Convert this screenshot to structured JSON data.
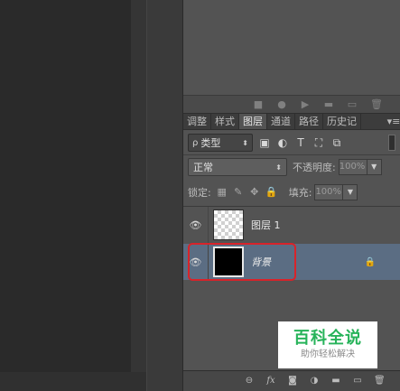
{
  "panel_tabs": [
    "调整",
    "样式",
    "图层",
    "通道",
    "路径",
    "历史记"
  ],
  "active_tab": "图层",
  "tab_menu_icon": "panel-menu-icon",
  "filter": {
    "kind_label": "类型",
    "icons": [
      "image-filter-icon",
      "adjustment-filter-icon",
      "type-filter-icon",
      "shape-filter-icon",
      "smart-object-filter-icon"
    ]
  },
  "blend": {
    "mode": "正常",
    "opacity_label": "不透明度:",
    "opacity_value": "100%"
  },
  "lock": {
    "label": "锁定:",
    "fill_label": "填充:",
    "fill_value": "100%"
  },
  "layers": [
    {
      "name": "图层 1",
      "thumbnail": "transparent",
      "visible": true,
      "selected": false,
      "locked": false
    },
    {
      "name": "背景",
      "thumbnail": "black",
      "visible": true,
      "selected": true,
      "locked": true
    }
  ],
  "watermark": {
    "title": "百科全说",
    "subtitle": "助你轻松解决"
  },
  "colors": {
    "panel_bg": "#535353",
    "selected_row": "#5b6d83",
    "highlight_border": "#d8232a",
    "watermark_green": "#27b35a"
  }
}
